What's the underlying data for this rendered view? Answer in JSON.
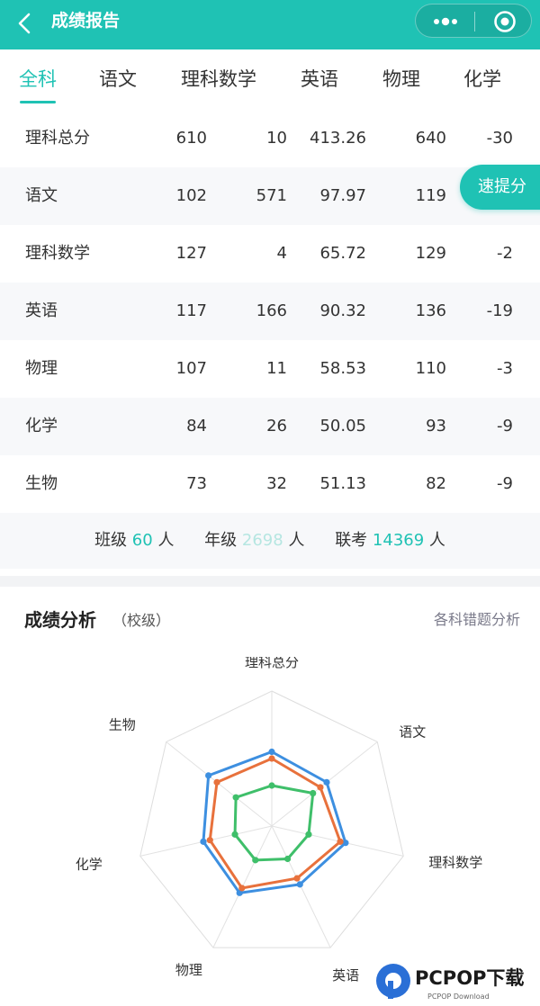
{
  "header": {
    "title": "成绩报告",
    "back_icon": "chevron-left-icon",
    "more_icon": "more-dots-icon",
    "target_icon": "target-icon"
  },
  "tabs": [
    {
      "label": "全科",
      "active": true
    },
    {
      "label": "语文",
      "active": false
    },
    {
      "label": "理科数学",
      "active": false
    },
    {
      "label": "英语",
      "active": false
    },
    {
      "label": "物理",
      "active": false
    },
    {
      "label": "化学",
      "active": false
    }
  ],
  "score_table": [
    {
      "subject": "理科总分",
      "score": "610",
      "rank": "10",
      "avg": "413.26",
      "max": "640",
      "diff": "-30"
    },
    {
      "subject": "语文",
      "score": "102",
      "rank": "571",
      "avg": "97.97",
      "max": "119",
      "diff": ""
    },
    {
      "subject": "理科数学",
      "score": "127",
      "rank": "4",
      "avg": "65.72",
      "max": "129",
      "diff": "-2"
    },
    {
      "subject": "英语",
      "score": "117",
      "rank": "166",
      "avg": "90.32",
      "max": "136",
      "diff": "-19"
    },
    {
      "subject": "物理",
      "score": "107",
      "rank": "11",
      "avg": "58.53",
      "max": "110",
      "diff": "-3"
    },
    {
      "subject": "化学",
      "score": "84",
      "rank": "26",
      "avg": "50.05",
      "max": "93",
      "diff": "-9"
    },
    {
      "subject": "生物",
      "score": "73",
      "rank": "32",
      "avg": "51.13",
      "max": "82",
      "diff": "-9"
    }
  ],
  "quick_button": {
    "label": "速提分"
  },
  "summary": {
    "class_label": "班级",
    "class_count": "60",
    "class_unit": "人",
    "grade_label": "年级",
    "grade_count": "2698",
    "grade_unit": "人",
    "joint_label": "联考",
    "joint_count": "14369",
    "joint_unit": "人"
  },
  "analysis": {
    "title": "成绩分析",
    "subtitle": "（校级）",
    "link": "各科错题分析"
  },
  "chart_data": {
    "type": "radar",
    "axes": [
      "理科总分",
      "语文",
      "理科数学",
      "英语",
      "物理",
      "化学",
      "生物"
    ],
    "range": [
      0,
      1
    ],
    "series": [
      {
        "color": "#3d8fe0",
        "values": [
          0.55,
          0.52,
          0.56,
          0.48,
          0.55,
          0.52,
          0.6
        ]
      },
      {
        "color": "#e8713c",
        "values": [
          0.5,
          0.46,
          0.52,
          0.43,
          0.51,
          0.47,
          0.52
        ]
      },
      {
        "color": "#3fbf6a",
        "values": [
          0.3,
          0.39,
          0.28,
          0.27,
          0.28,
          0.28,
          0.34
        ]
      }
    ],
    "grid_levels": 5
  },
  "watermark": {
    "brand": "PCPOP下载",
    "sub": "PCPOP Download"
  }
}
